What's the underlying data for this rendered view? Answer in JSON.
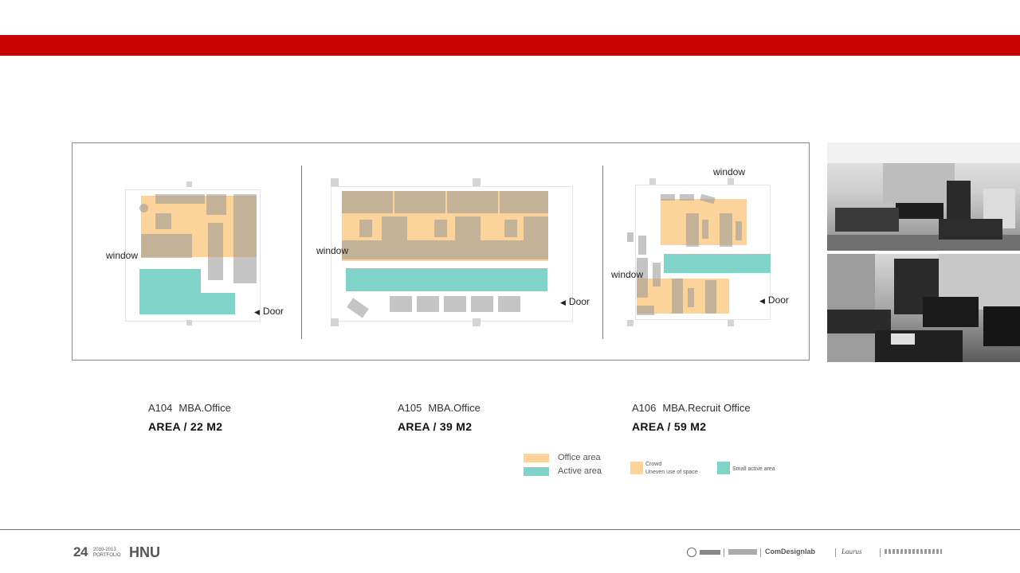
{
  "plans": {
    "a104": {
      "window_label": "window",
      "door_label": "Door",
      "room_code": "A104",
      "room_name": "MBA.Office",
      "area": "AREA / 22 M2"
    },
    "a105": {
      "window_label": "window",
      "door_label": "Door",
      "room_code": "A105",
      "room_name": "MBA.Office",
      "area": "AREA / 39 M2"
    },
    "a106": {
      "window_label": "window",
      "window_label_top": "window",
      "door_label": "Door",
      "room_code": "A106",
      "room_name": "MBA.Recruit Office",
      "area": "AREA / 59 M2"
    }
  },
  "legend": {
    "office_area": "Office area",
    "active_area": "Active area",
    "crowd_line1": "Crowd",
    "crowd_line2": "Uneven use of space",
    "small_active": "Small active area",
    "colors": {
      "office": "#fbd39b",
      "active": "#7fd3c8",
      "accent_red": "#c70000"
    }
  },
  "footer": {
    "page_number": "24",
    "years": "2010-2013",
    "portfolio": "PORTFOLIO",
    "school": "HNU",
    "partner_logos": [
      "university-seal-logo",
      "comdesignlab-logo",
      "laurus-logo"
    ],
    "partner_text_1": "ComDesignlab",
    "partner_text_2": "Laurus"
  }
}
